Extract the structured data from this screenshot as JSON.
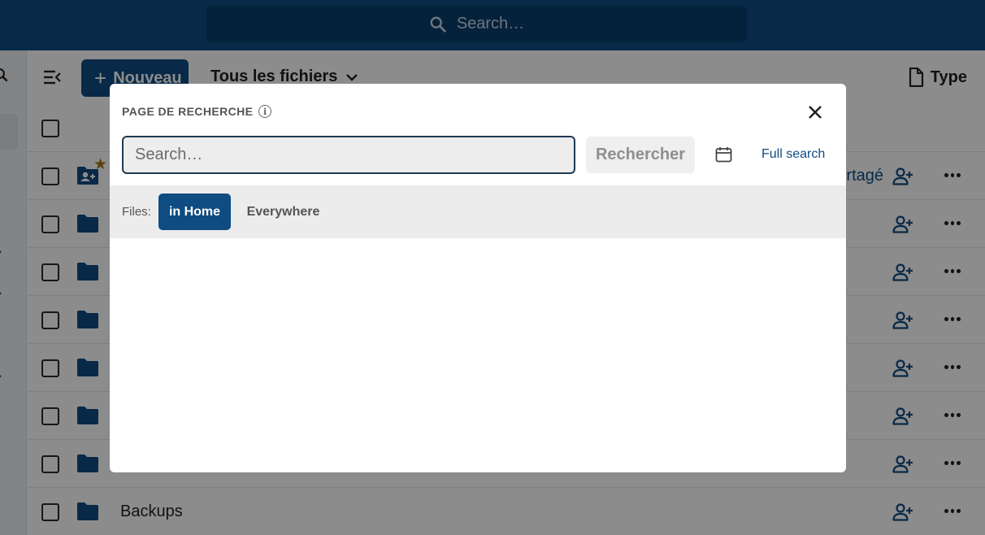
{
  "header": {
    "search_placeholder": "Search…"
  },
  "toolbar": {
    "new_label": "Nouveau",
    "breadcrumb": "Tous les fichiers",
    "type_filter": "Type"
  },
  "file_list": {
    "rows": [
      {
        "name": "",
        "kind": "shared-folder",
        "favorite": true,
        "shared_text": "rtagé"
      },
      {
        "name": "",
        "kind": "folder"
      },
      {
        "name": "",
        "kind": "folder"
      },
      {
        "name": "",
        "kind": "folder"
      },
      {
        "name": "",
        "kind": "folder"
      },
      {
        "name": "",
        "kind": "folder"
      },
      {
        "name": "",
        "kind": "folder"
      },
      {
        "name": "Backups",
        "kind": "folder"
      }
    ]
  },
  "modal": {
    "title": "PAGE DE RECHERCHE",
    "info_glyph": "i",
    "search_placeholder": "Search…",
    "search_value": "",
    "search_button": "Rechercher",
    "full_search": "Full search",
    "filter_label": "Files:",
    "filters": [
      {
        "label": "in Home",
        "active": true
      },
      {
        "label": "Everywhere",
        "active": false
      }
    ]
  },
  "colors": {
    "primary": "#0f4c81",
    "header_search_bg": "#0a3f6e",
    "filter_bar_bg": "#ececec"
  },
  "icons": [
    "search-icon",
    "menu-toggle-icon",
    "plus-icon",
    "chevron-down-icon",
    "file-icon",
    "folder-icon",
    "shared-folder-icon",
    "star-icon",
    "share-user-icon",
    "more-icon",
    "info-icon",
    "close-icon",
    "calendar-icon"
  ]
}
